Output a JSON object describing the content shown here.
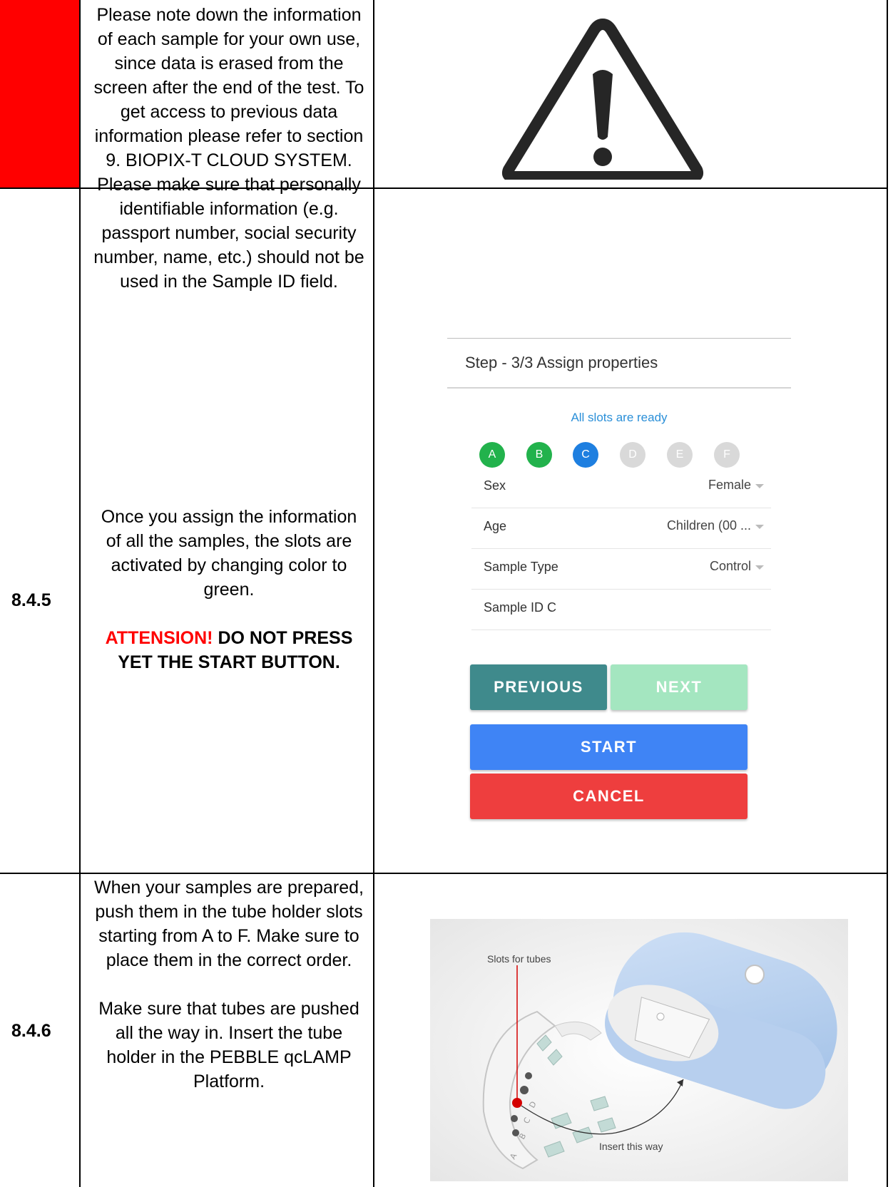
{
  "rows": [
    {
      "step": "",
      "paragraphs": [
        "Please note down the information of each sample for your own use, since data is erased from the screen after the end of the test. To get access to previous data information please refer to section 9. BIOPIX-T CLOUD SYSTEM.",
        "Please make sure that personally identifiable information (e.g. passport number, social security number, name, etc.) should not be used in the Sample ID field."
      ],
      "image": "warning-icon"
    },
    {
      "step": "8.4.5",
      "paragraphs": [
        "Once you assign the information of  all the samples, the slots are activated by changing color to green."
      ],
      "attention_prefix": "ATTENSION!",
      "attention_rest": " DO NOT PRESS YET THE START BUTTON."
    },
    {
      "step": "8.4.6",
      "paragraphs": [
        "When your samples are prepared, push them in the tube holder slots starting from A to F. Make sure to place them in the correct order.",
        "Make sure that tubes are pushed all the way in. Insert the tube holder in the PEBBLE qcLAMP Platform."
      ]
    }
  ],
  "app": {
    "title": "Step - 3/3 Assign properties",
    "status": "All slots are ready",
    "slots": [
      {
        "label": "A",
        "color": "#22b24c"
      },
      {
        "label": "B",
        "color": "#22b24c"
      },
      {
        "label": "C",
        "color": "#1e7fe0"
      },
      {
        "label": "D",
        "color": "#d9d9d9"
      },
      {
        "label": "E",
        "color": "#d9d9d9"
      },
      {
        "label": "F",
        "color": "#d9d9d9"
      }
    ],
    "fields": [
      {
        "label": "Sex",
        "value": "Female"
      },
      {
        "label": "Age",
        "value": "Children (00 ..."
      },
      {
        "label": "Sample Type",
        "value": "Control"
      }
    ],
    "sample_id_label": "Sample ID  C",
    "buttons": {
      "previous": "PREVIOUS",
      "next": "NEXT",
      "start": "START",
      "cancel": "CANCEL"
    },
    "colors": {
      "previous": "#3f8a8c",
      "next": "#a4e6c0",
      "start": "#3f84f5",
      "cancel": "#ee3e3e"
    }
  },
  "illustration": {
    "callout_slots": "Slots for tubes",
    "callout_insert": "Insert this way",
    "slot_letters": [
      "A",
      "B",
      "C",
      "D"
    ]
  }
}
